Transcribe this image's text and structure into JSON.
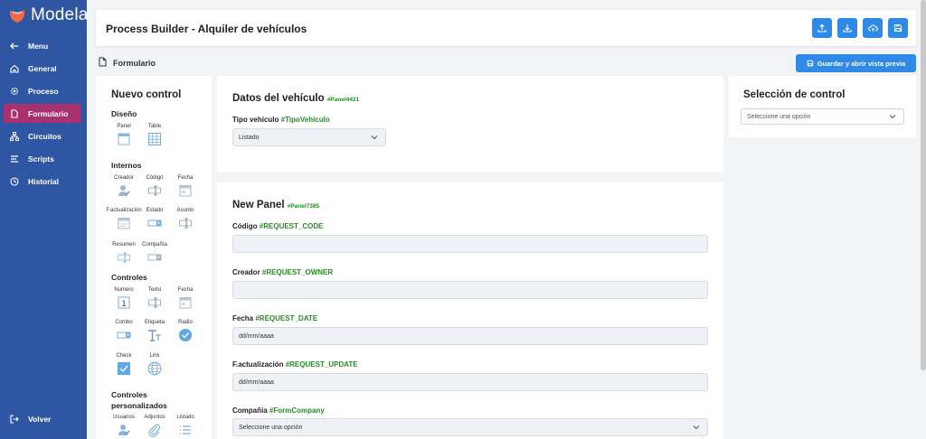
{
  "brand": {
    "name": "Modela"
  },
  "sidebar": {
    "items": [
      {
        "label": "Menu",
        "icon": "arrow-left-icon"
      },
      {
        "label": "General",
        "icon": "home-icon"
      },
      {
        "label": "Proceso",
        "icon": "gear-icon"
      },
      {
        "label": "Formulario",
        "icon": "document-icon",
        "active": true
      },
      {
        "label": "Circuitos",
        "icon": "sitemap-icon"
      },
      {
        "label": "Scripts",
        "icon": "lines-icon"
      },
      {
        "label": "Historial",
        "icon": "clock-icon"
      }
    ],
    "back_label": "Volver"
  },
  "header": {
    "title": "Process Builder - Alquiler de vehículos",
    "buttons": [
      "upload-icon",
      "download-icon",
      "cloud-upload-icon",
      "save-icon"
    ]
  },
  "subheader": {
    "title": "Formulario",
    "save_button": "Guardar y abrir vista previa"
  },
  "palette": {
    "title": "Nuevo control",
    "sections": {
      "diseno": "Diseño",
      "internos": "Internos",
      "controles": "Controles",
      "personalizados": "Controles personalizados"
    },
    "diseno": [
      "Panel",
      "Table"
    ],
    "internos": [
      "Creador",
      "Código",
      "Fecha",
      "F.actualización",
      "Estado",
      "Asunto",
      "Resumen",
      "Compañía"
    ],
    "controles": [
      "Numero",
      "Texto",
      "Fecha",
      "Combo",
      "Etiqueta",
      "Radio",
      "Check",
      "Link"
    ],
    "personalizados": [
      "Usuarios",
      "Adjuntos",
      "Listado"
    ]
  },
  "panel1": {
    "title": "Datos del vehículo",
    "tag": "#Panel4421",
    "field_label": "Tipo vehículo",
    "field_tag": "#TipoVehiculo",
    "field_value": "Listado"
  },
  "panel2": {
    "title": "New Panel",
    "tag": "#Panel7385",
    "fields": [
      {
        "label": "Código",
        "tag": "#REQUEST_CODE",
        "value": ""
      },
      {
        "label": "Creador",
        "tag": "#REQUEST_OWNER",
        "value": ""
      },
      {
        "label": "Fecha",
        "tag": "#REQUEST_DATE",
        "value": "dd/mm/aaaa"
      },
      {
        "label": "F.actualización",
        "tag": "#REQUEST_UPDATE",
        "value": "dd/mm/aaaa"
      },
      {
        "label": "Compañía",
        "tag": "#FormCompany",
        "value": "Seleccione una opción"
      }
    ]
  },
  "control_selection": {
    "title": "Selección de control",
    "placeholder": "Seleccione una opción"
  },
  "colors": {
    "sidebar": "#2f56a3",
    "active": "#a9316f",
    "accent": "#2e8ae6",
    "tag": "#2a8a2a"
  }
}
